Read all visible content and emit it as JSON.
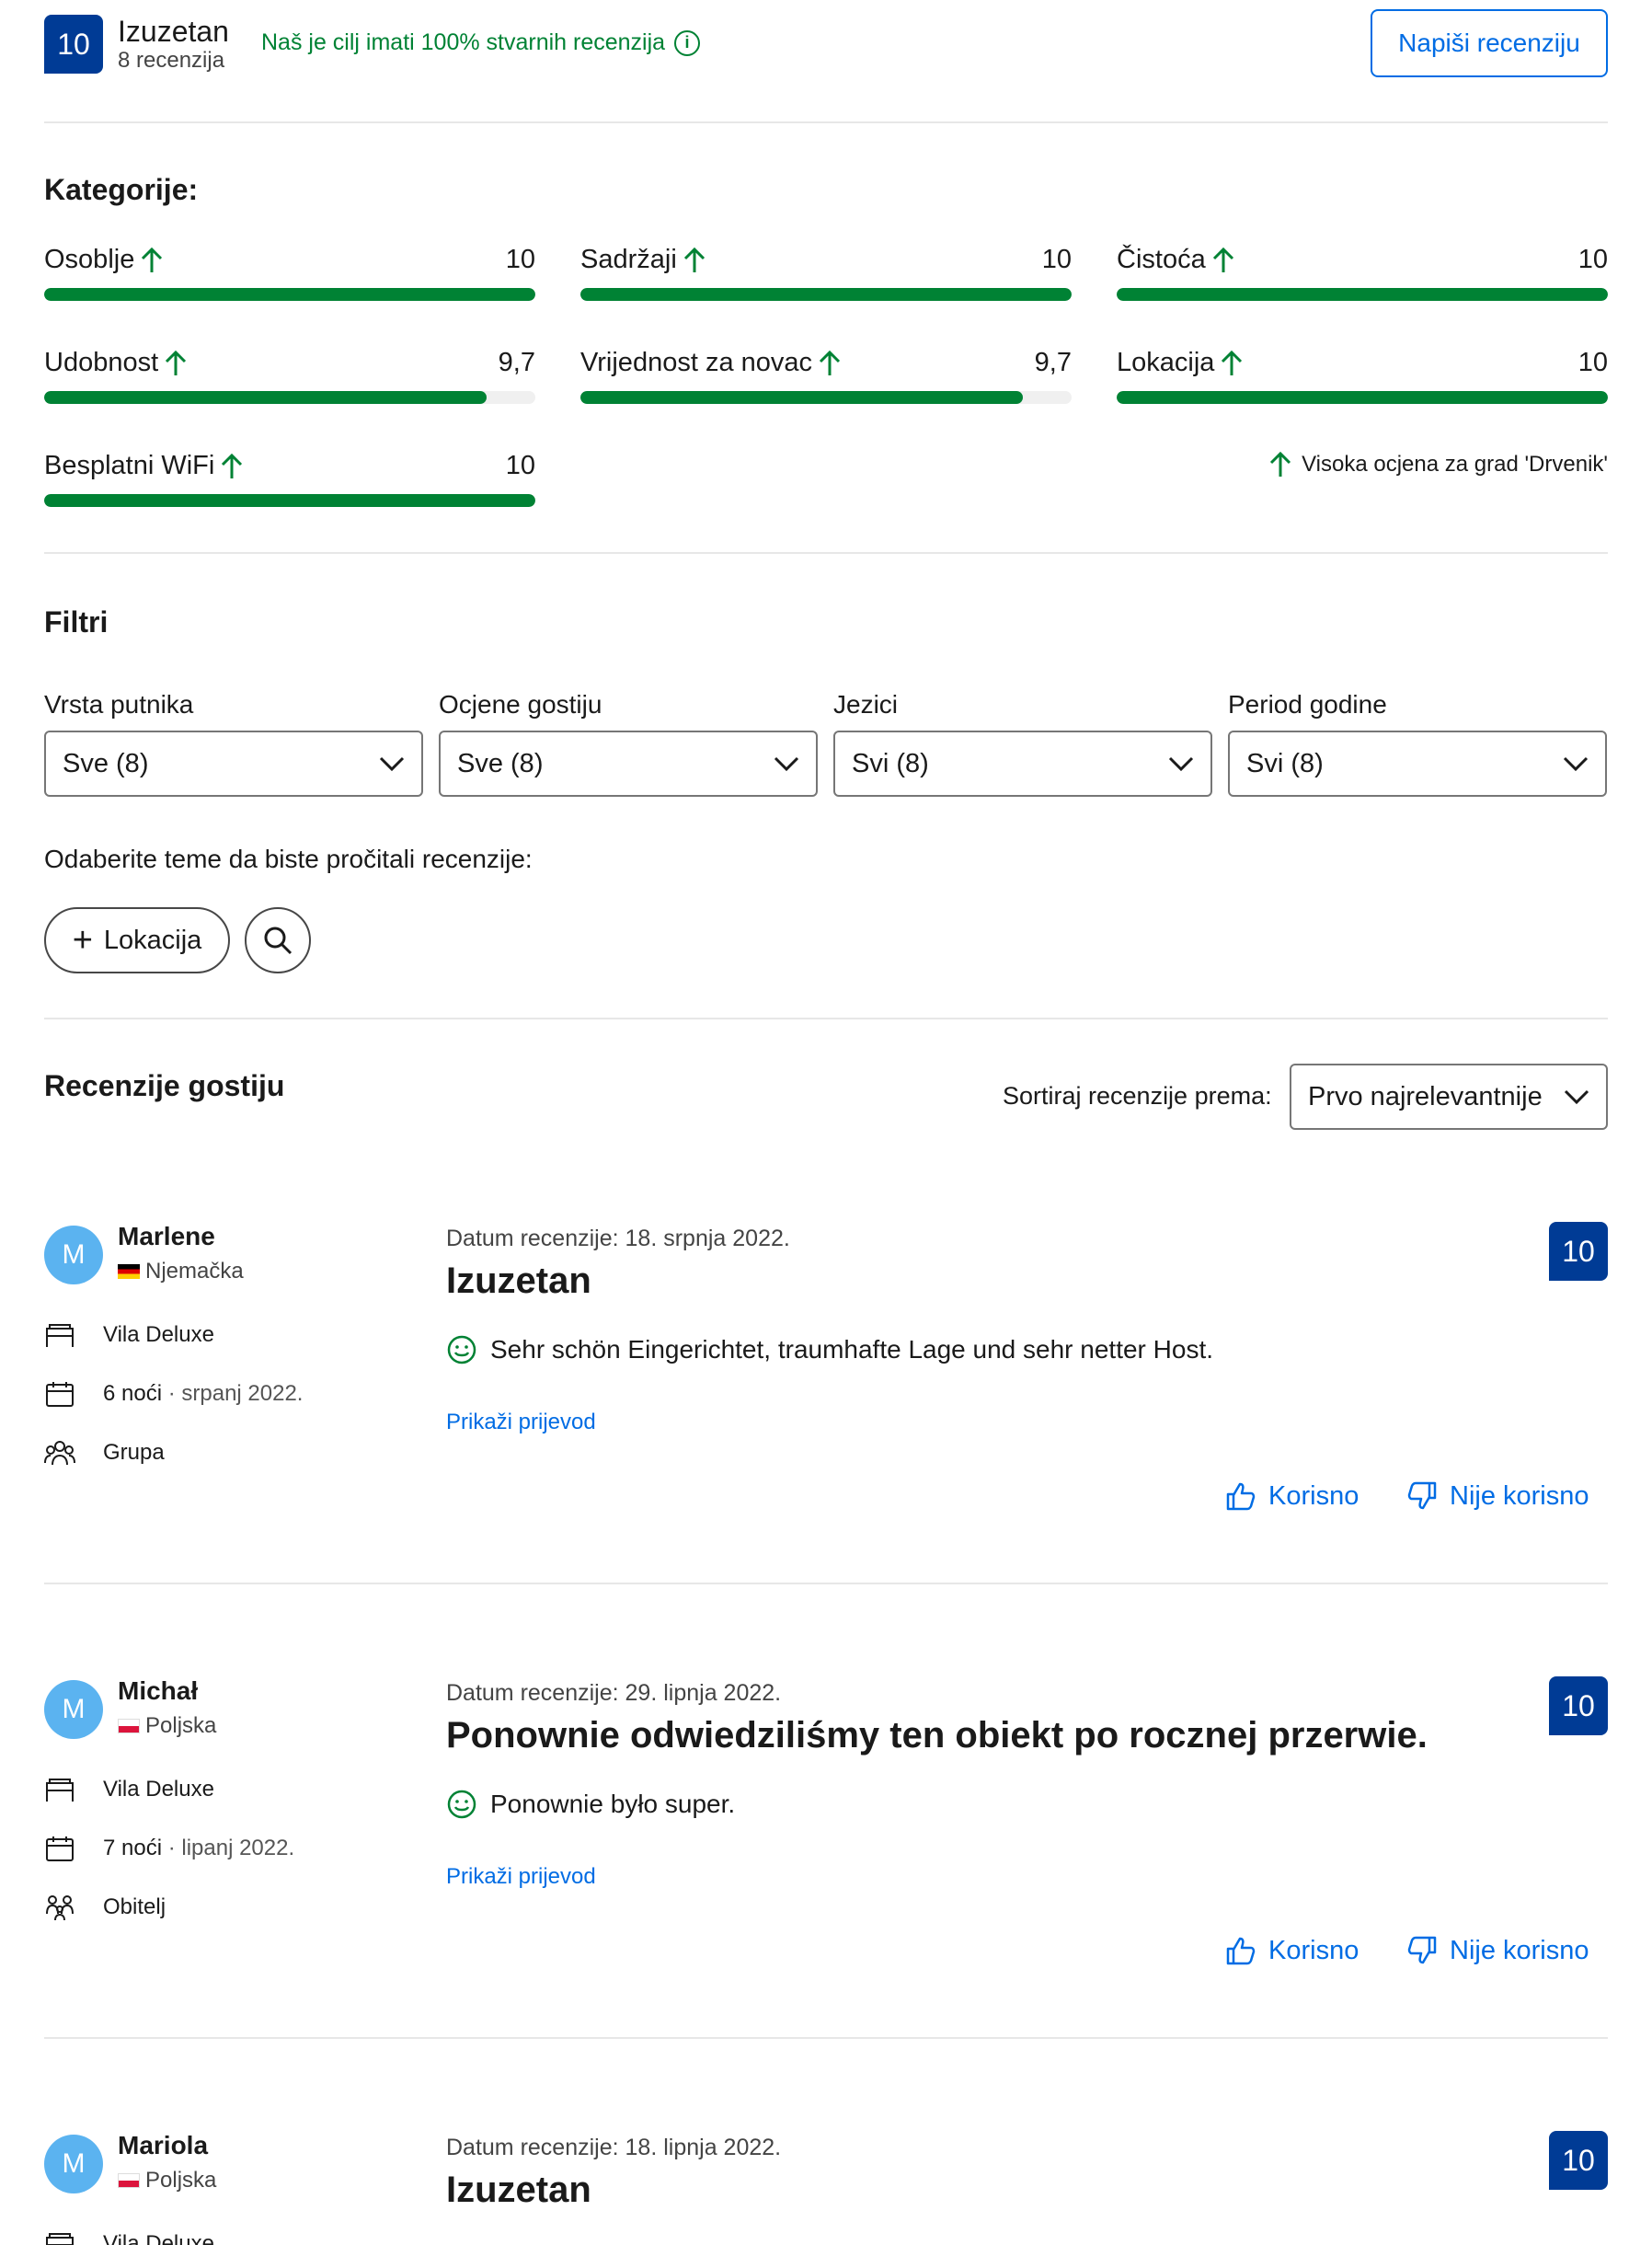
{
  "header": {
    "score": "10",
    "overall_label": "Izuzetan",
    "review_count": "8 recenzija",
    "claim": "Naš je cilj imati 100% stvarnih recenzija",
    "write_review_label": "Napiši recenziju"
  },
  "categories": {
    "title": "Kategorije:",
    "items": [
      {
        "name": "Osoblje",
        "score": "10",
        "fraction": 1.0
      },
      {
        "name": "Sadržaji",
        "score": "10",
        "fraction": 1.0
      },
      {
        "name": "Čistoća",
        "score": "10",
        "fraction": 1.0
      },
      {
        "name": "Udobnost",
        "score": "9,7",
        "fraction": 0.9
      },
      {
        "name": "Vrijednost za novac",
        "score": "9,7",
        "fraction": 0.9
      },
      {
        "name": "Lokacija",
        "score": "10",
        "fraction": 1.0
      },
      {
        "name": "Besplatni WiFi",
        "score": "10",
        "fraction": 1.0
      }
    ],
    "high_score_note": "Visoka ocjena za grad 'Drvenik'",
    "accent_color": "#008234"
  },
  "filters": {
    "title": "Filtri",
    "items": [
      {
        "label": "Vrsta putnika",
        "value": "Sve (8)"
      },
      {
        "label": "Ocjene gostiju",
        "value": "Sve (8)"
      },
      {
        "label": "Jezici",
        "value": "Svi (8)"
      },
      {
        "label": "Period godine",
        "value": "Svi (8)"
      }
    ],
    "topics_hint": "Odaberite teme da biste pročitali recenzije:",
    "topic_pill": "Lokacija"
  },
  "reviews_section": {
    "title": "Recenzije gostiju",
    "sort_label": "Sortiraj recenzije prema:",
    "sort_value": "Prvo najrelevantnije"
  },
  "reviews": [
    {
      "initial": "M",
      "name": "Marlene",
      "country": "Njemačka",
      "room": "Vila Deluxe",
      "nights": "6 noći",
      "stay_period": "· srpanj 2022.",
      "group": "Grupa",
      "date": "Datum recenzije: 18. srpnja 2022.",
      "title": "Izuzetan",
      "score": "10",
      "text": "Sehr schön Eingerichtet, traumhafte Lage und sehr netter Host.",
      "translate": "Prikaži prijevod",
      "helpful": "Korisno",
      "not_helpful": "Nije korisno"
    },
    {
      "initial": "M",
      "name": "Michał",
      "country": "Poljska",
      "room": "Vila Deluxe",
      "nights": "7 noći",
      "stay_period": "· lipanj 2022.",
      "group": "Obitelj",
      "date": "Datum recenzije: 29. lipnja 2022.",
      "title": "Ponownie odwiedziliśmy ten obiekt po rocznej przerwie.",
      "score": "10",
      "text": "Ponownie było super.",
      "translate": "Prikaži prijevod",
      "helpful": "Korisno",
      "not_helpful": "Nije korisno"
    },
    {
      "initial": "M",
      "name": "Mariola",
      "country": "Poljska",
      "room": "Vila Deluxe",
      "date": "Datum recenzije: 18. lipnja 2022.",
      "title": "Izuzetan",
      "score": "10"
    }
  ]
}
